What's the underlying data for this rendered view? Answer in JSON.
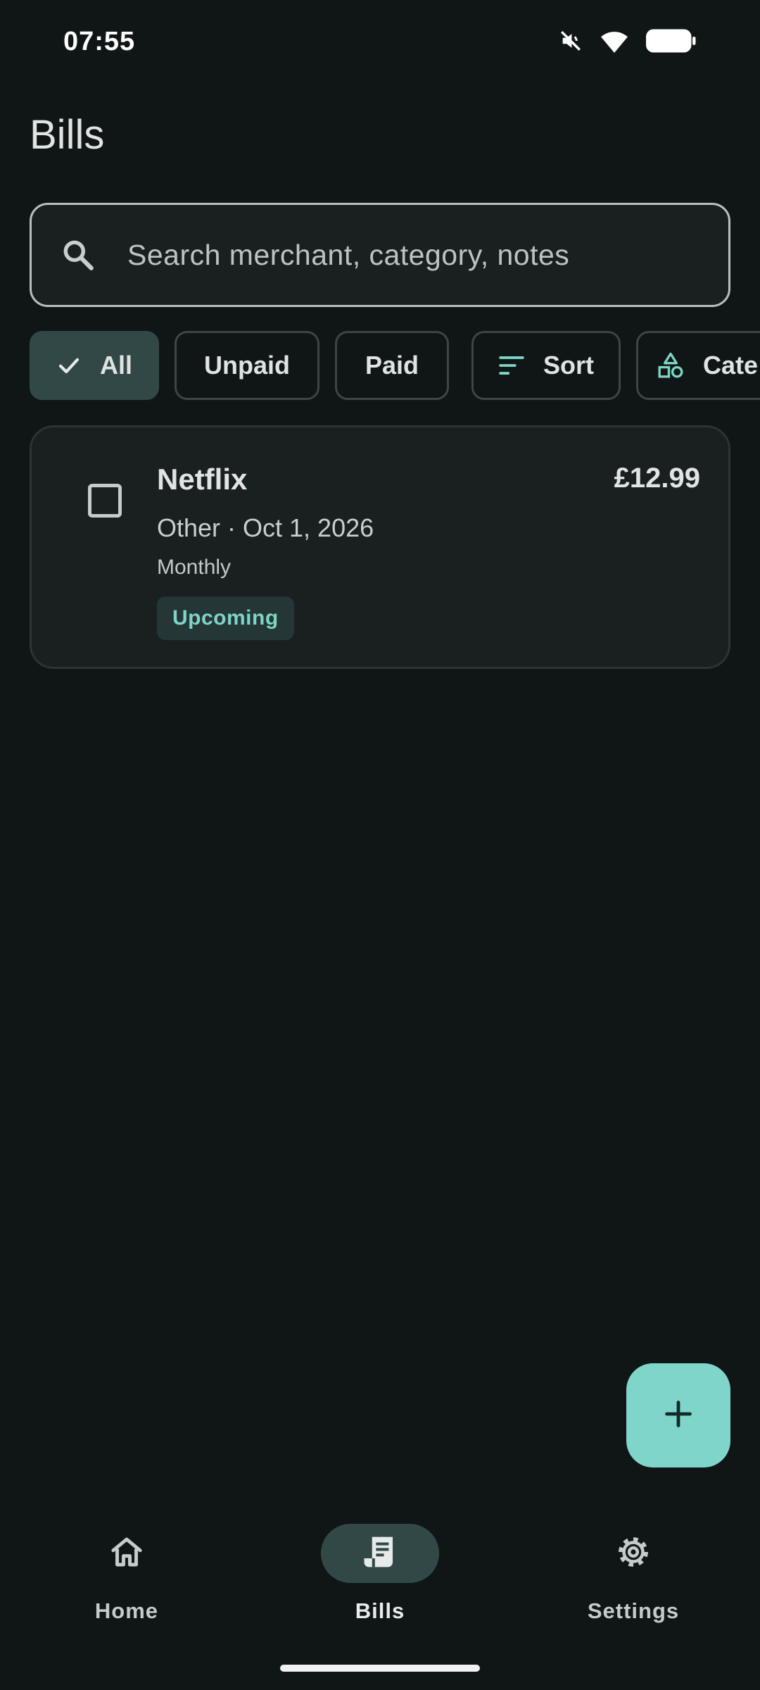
{
  "status_bar": {
    "time": "07:55",
    "icons": [
      "mute-icon",
      "wifi-icon",
      "battery-icon"
    ]
  },
  "page": {
    "title": "Bills"
  },
  "search": {
    "placeholder": "Search merchant, category, notes",
    "icon": "search-icon"
  },
  "filters": {
    "chips": [
      {
        "label": "All",
        "selected": true,
        "icon": "check-icon"
      },
      {
        "label": "Unpaid",
        "selected": false
      },
      {
        "label": "Paid",
        "selected": false
      },
      {
        "label": "Sort",
        "selected": false,
        "icon": "sort-icon"
      },
      {
        "label": "Cate",
        "selected": false,
        "icon": "category-shapes-icon"
      }
    ]
  },
  "bills": [
    {
      "merchant": "Netflix",
      "amount": "£12.99",
      "meta": "Other · Oct 1, 2026",
      "frequency": "Monthly",
      "status": "Upcoming",
      "paid": false
    }
  ],
  "fab": {
    "icon": "plus-icon"
  },
  "nav": {
    "items": [
      {
        "label": "Home",
        "icon": "home-icon",
        "active": false
      },
      {
        "label": "Bills",
        "icon": "receipt-icon",
        "active": true
      },
      {
        "label": "Settings",
        "icon": "gear-icon",
        "active": false
      }
    ]
  },
  "colors": {
    "background": "#101616",
    "accent": "#80d5ca",
    "selected_chip": "#324847",
    "status_badge_text": "#7ed4c7"
  }
}
